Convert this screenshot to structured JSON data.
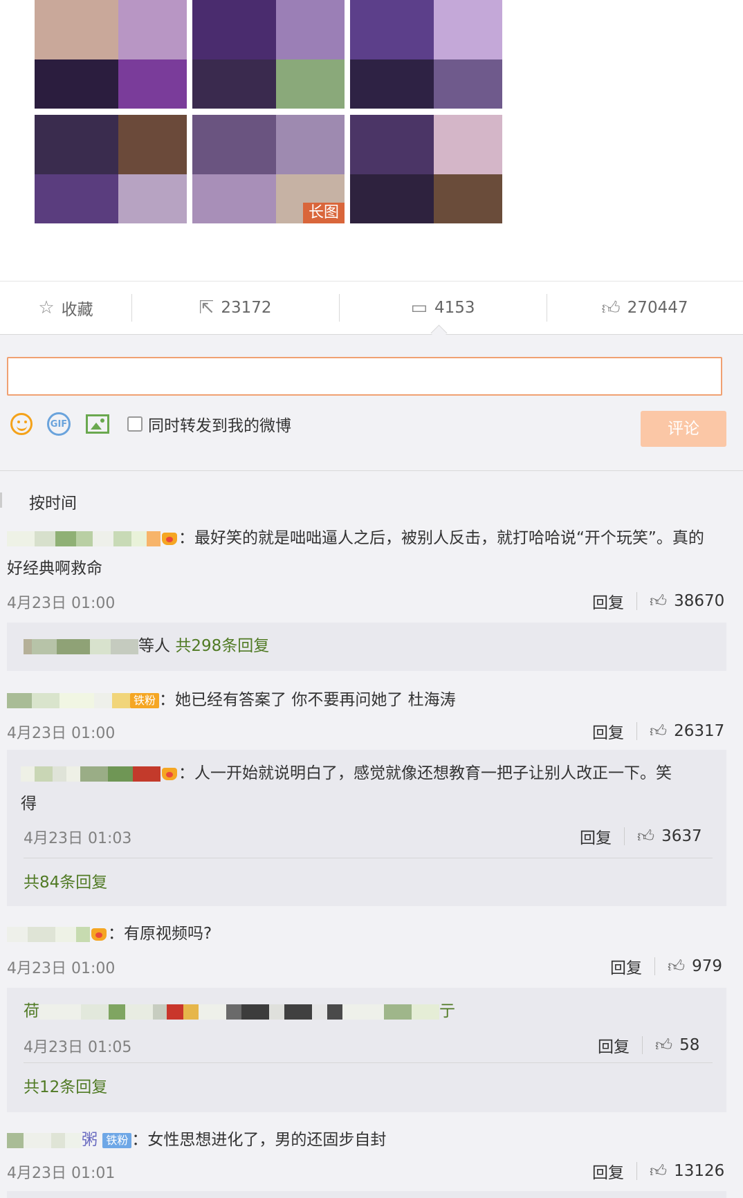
{
  "actions": {
    "favorite": "收藏",
    "repost_count": "23172",
    "comment_count": "4153",
    "like_count": "270447"
  },
  "composer": {
    "placeholder": "",
    "repost_label": "同时转发到我的微博",
    "submit_label": "评论",
    "gif_label": "GIF"
  },
  "images": {
    "long_tag": "长图"
  },
  "sort": {
    "by_time": "按时间"
  },
  "comments": [
    {
      "text_line1": "：最好笑的就是咄咄逼人之后，被别人反击，就打哈哈说“开个玩笑”。真的",
      "text_line2": "好经典啊救命",
      "time": "4月23日 01:00",
      "reply": "回复",
      "likes": "38670",
      "replies_prefix": "等人",
      "replies_link": "共298条回复"
    },
    {
      "badge": "铁粉",
      "text": "：她已经有答案了 你不要再问她了 杜海涛",
      "time": "4月23日 01:00",
      "reply": "回复",
      "likes": "26317",
      "sub": {
        "text_line1": "：人一开始就说明白了，感觉就像还想教育一把子让别人改正一下。笑",
        "text_line2": "得",
        "time": "4月23日 01:03",
        "reply": "回复",
        "likes": "3637",
        "more": "共84条回复"
      }
    },
    {
      "text": "：有原视频吗?",
      "time": "4月23日 01:00",
      "reply": "回复",
      "likes": "979",
      "sub": {
        "name_start": "荷",
        "name_end": "亍",
        "time": "4月23日 01:05",
        "reply": "回复",
        "likes": "58",
        "more": "共12条回复"
      }
    },
    {
      "name_tail": "粥",
      "badge": "铁粉",
      "text": "：女性思想进化了，男的还固步自封",
      "time": "4月23日 01:01",
      "reply": "回复",
      "likes": "13126"
    }
  ]
}
